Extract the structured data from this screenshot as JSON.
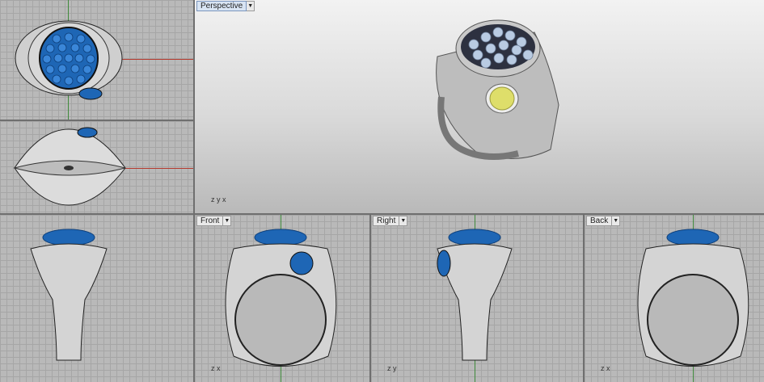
{
  "viewports": {
    "perspective": {
      "title": "Perspective",
      "menu_icon": "dropdown-arrow"
    },
    "front": {
      "title": "Front",
      "menu_icon": "dropdown-arrow"
    },
    "right": {
      "title": "Right",
      "menu_icon": "dropdown-arrow"
    },
    "back": {
      "title": "Back",
      "menu_icon": "dropdown-arrow"
    }
  },
  "axis_labels": {
    "x": "x",
    "y": "y",
    "z": "z"
  },
  "colors": {
    "stone_blue": "#1e66b5",
    "stone_yellow": "#dede6a",
    "metal": "#c8c8c8",
    "x_axis": "#b53a2f",
    "y_axis": "#3f8a3b",
    "active_label": "#d8e4f3"
  }
}
